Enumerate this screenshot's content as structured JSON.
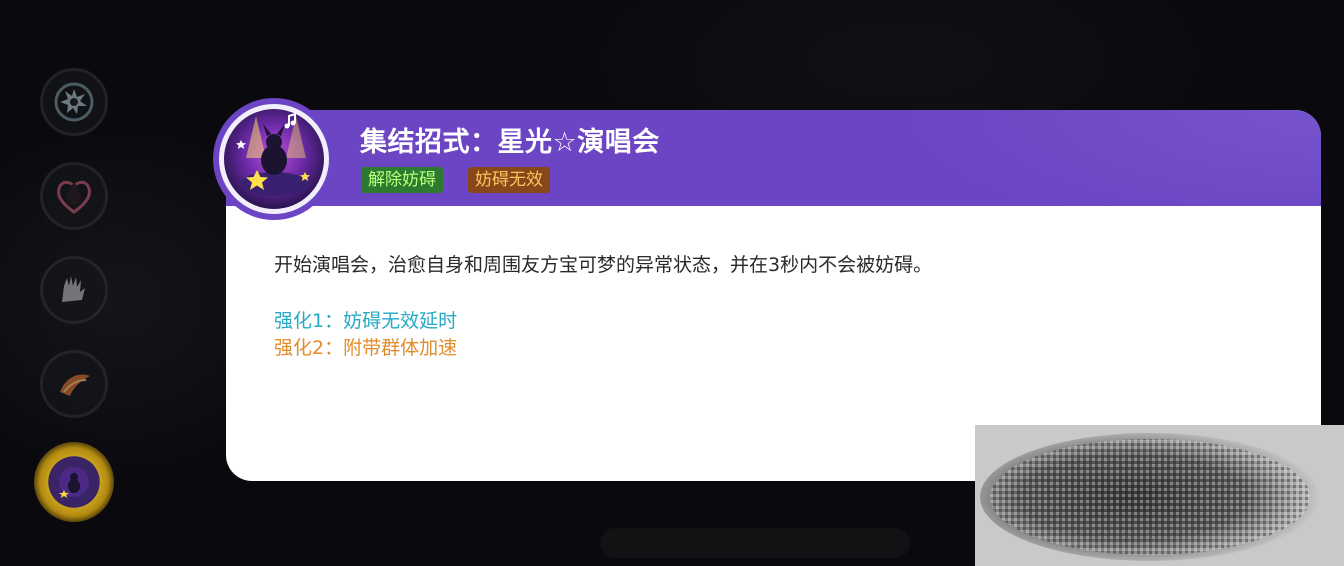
{
  "skill_rail": {
    "slots": [
      {
        "icon": "gear-burst-icon"
      },
      {
        "icon": "heart-creature-icon"
      },
      {
        "icon": "hand-wave-icon"
      },
      {
        "icon": "feather-swirl-icon"
      },
      {
        "icon": "unite-star-concert-icon",
        "active": true
      }
    ]
  },
  "skill_card": {
    "emblem_icon": "star-concert-emblem-icon",
    "title": "集结招式：星光☆演唱会",
    "tags": [
      "解除妨碍",
      "妨碍无效"
    ],
    "description": "开始演唱会，治愈自身和周围友方宝可梦的异常状态，并在3秒内不会被妨碍。",
    "upgrade_1": "强化1：妨碍无效延时",
    "upgrade_2": "强化2：附带群体加速"
  },
  "colors": {
    "header": "#6b45c4",
    "tag_1_bg": "#2c7a2f",
    "tag_1_text": "#b9ff7a",
    "tag_2_bg": "#874719",
    "tag_2_text": "#ffc35e",
    "upgrade_1": "#26a9c4",
    "upgrade_2": "#e38c2a"
  }
}
